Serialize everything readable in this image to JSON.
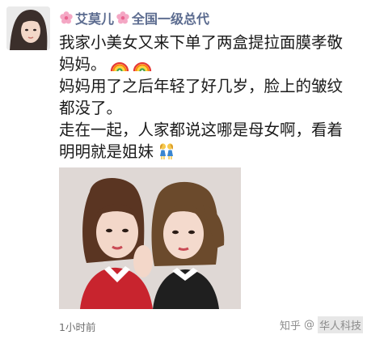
{
  "post": {
    "author": "艾莫儿",
    "author_title": "全国一级总代",
    "lines": [
      "我家小美女又来下单了两盒提拉面膜孝敬",
      "妈妈。",
      "妈妈用了之后年轻了好几岁，脸上的皱纹",
      "都没了。",
      "走在一起，人家都说这哪是母女啊，看着",
      "明明就是姐妹"
    ],
    "time": "1小时前"
  },
  "icons": {
    "author_prefix": "cherry-blossom-icon",
    "author_mid": "cherry-blossom-icon",
    "line2_emoji": "rainbow-icon",
    "line6_emoji": "two-women-icon"
  },
  "colors": {
    "author_name": "#5b6b8f",
    "body_text": "#1a1a1a",
    "time_text": "#6f6f6f"
  },
  "watermark": {
    "site": "知乎",
    "sep": "@",
    "name": "华人科技"
  }
}
